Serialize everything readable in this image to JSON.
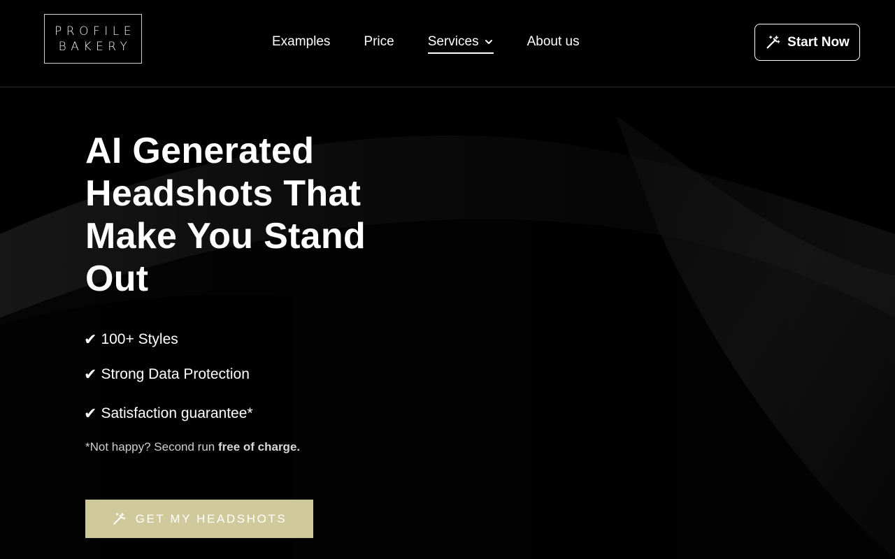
{
  "brand": {
    "line1": "PROFILE",
    "line2": "BAKERY"
  },
  "nav": {
    "items": [
      {
        "label": "Examples"
      },
      {
        "label": "Price"
      },
      {
        "label": "Services",
        "active": true,
        "has_dropdown": true
      },
      {
        "label": "About us"
      }
    ]
  },
  "header": {
    "cta_label": "Start Now",
    "cta_icon": "magic-wand-icon"
  },
  "hero": {
    "title": "AI Generated Headshots That Make You Stand Out",
    "features": [
      {
        "check": "✔",
        "text": "100+ Styles"
      },
      {
        "check": "✔",
        "text": "Strong Data Protection"
      },
      {
        "check": "✔",
        "text": "Satisfaction guarantee*"
      }
    ],
    "note_prefix": "*Not happy? Second run ",
    "note_bold": "free of charge.",
    "cta_label": "GET MY HEADSHOTS",
    "cta_icon": "magic-wand-icon"
  },
  "colors": {
    "background": "#000000",
    "accent": "#d0c99b",
    "text": "#ffffff",
    "muted": "#cfcfcf"
  }
}
